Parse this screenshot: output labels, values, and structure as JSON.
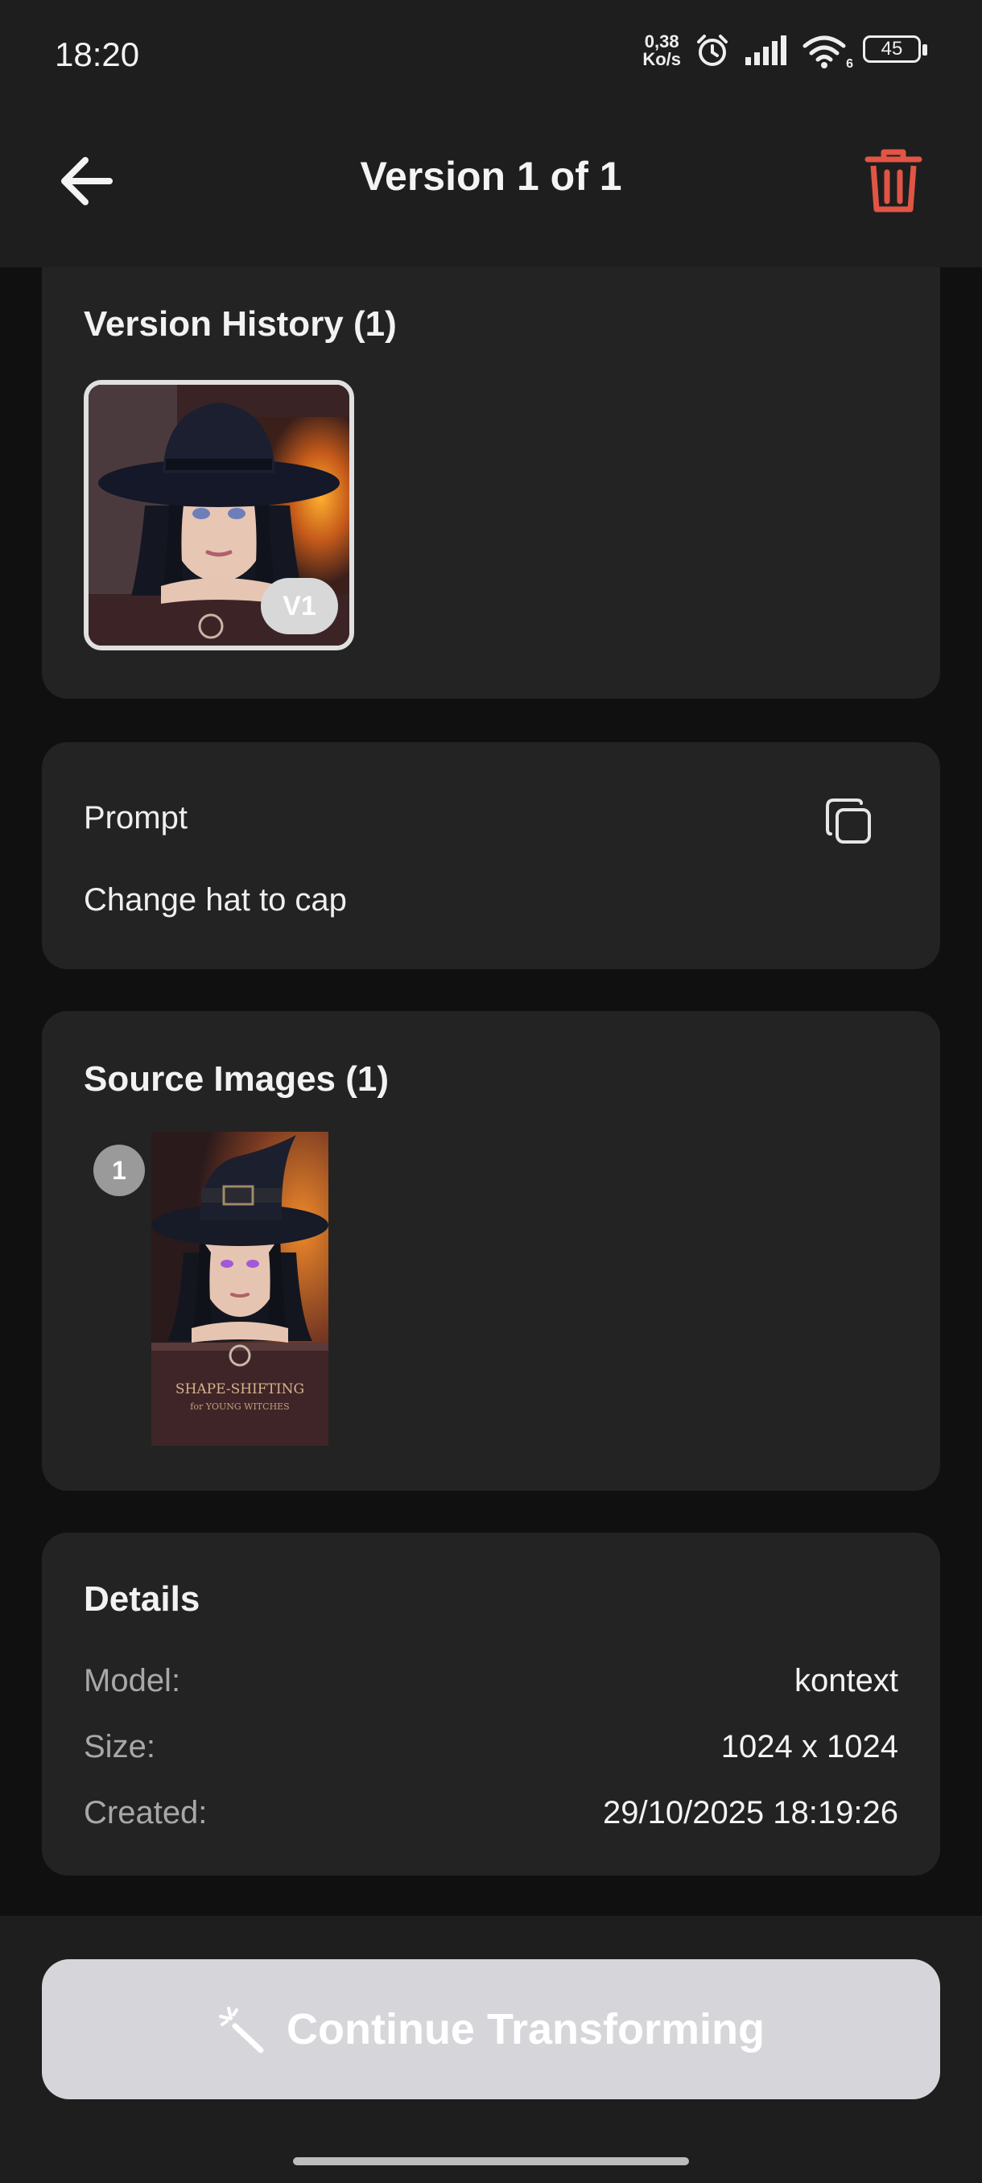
{
  "status_bar": {
    "time": "18:20",
    "net_speed_value": "0,38",
    "net_speed_unit": "Ko/s",
    "wifi_label": "6",
    "battery": "45"
  },
  "app_bar": {
    "title": "Version 1 of 1",
    "back_icon": "arrow-left-icon",
    "delete_icon": "trash-icon",
    "delete_color": "#e05545"
  },
  "version_history": {
    "title": "Version History (1)",
    "versions": [
      {
        "badge": "V1",
        "selected": true
      }
    ]
  },
  "prompt": {
    "label": "Prompt",
    "text": "Change hat to cap",
    "copy_icon": "copy-icon"
  },
  "source_images": {
    "title": "Source Images (1)",
    "images": [
      {
        "index": "1",
        "book_title": "SHAPE-SHIFTING",
        "book_subtitle": "for YOUNG WITCHES"
      }
    ]
  },
  "details": {
    "title": "Details",
    "rows": [
      {
        "label": "Model:",
        "value": "kontext"
      },
      {
        "label": "Size:",
        "value": "1024 x 1024"
      },
      {
        "label": "Created:",
        "value": "29/10/2025 18:19:26"
      }
    ]
  },
  "cta": {
    "label": "Continue Transforming",
    "icon": "magic-wand-icon"
  }
}
